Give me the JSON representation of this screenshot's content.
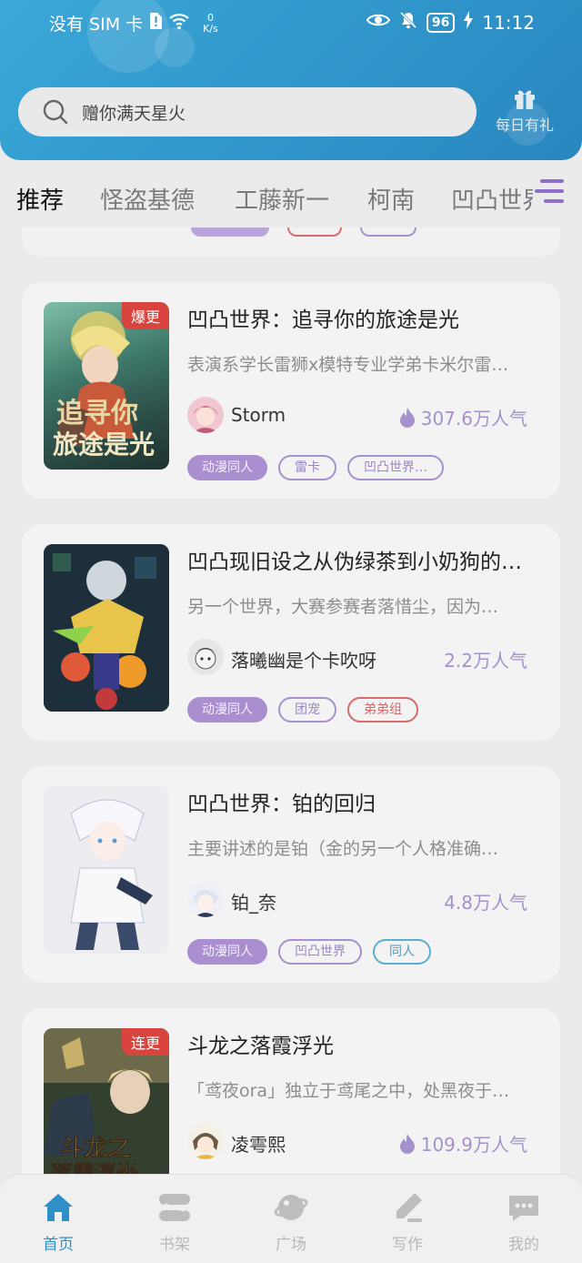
{
  "status_bar": {
    "carrier": "没有 SIM 卡",
    "speed_value": "0",
    "speed_unit": "K/s",
    "battery": "96",
    "time": "11:12"
  },
  "search": {
    "placeholder": "赠你满天星火"
  },
  "gift": {
    "label": "每日有礼"
  },
  "tabs": [
    {
      "label": "推荐",
      "active": true
    },
    {
      "label": "怪盗基德"
    },
    {
      "label": "工藤新一"
    },
    {
      "label": "柯南"
    },
    {
      "label": "凹凸世界"
    }
  ],
  "books": [
    {
      "badge": "爆更",
      "title": "凹凸世界：追寻你的旅途是光",
      "desc": "表演系学长雷狮x模特专业学弟卡米尔雷…",
      "author": "Storm",
      "popularity": "307.6万人气",
      "hot": true,
      "tags": [
        {
          "label": "动漫同人",
          "style": "filled"
        },
        {
          "label": "雷卡",
          "style": "outline-purple"
        },
        {
          "label": "凹凸世界…",
          "style": "outline-purple"
        }
      ]
    },
    {
      "badge": "",
      "title": "凹凸现旧设之从伪绿茶到小奶狗的…",
      "desc": "另一个世界，大赛参赛者落惜尘，因为…",
      "author": "落曦幽是个卡吹呀",
      "popularity": "2.2万人气",
      "hot": false,
      "tags": [
        {
          "label": "动漫同人",
          "style": "filled"
        },
        {
          "label": "团宠",
          "style": "outline-purple"
        },
        {
          "label": "弟弟组",
          "style": "outline-red"
        }
      ]
    },
    {
      "badge": "",
      "title": "凹凸世界：铂的回归",
      "desc": "主要讲述的是铂（金的另一个人格准确…",
      "author": "铂_奈",
      "popularity": "4.8万人气",
      "hot": false,
      "tags": [
        {
          "label": "动漫同人",
          "style": "filled"
        },
        {
          "label": "凹凸世界",
          "style": "outline-purple"
        },
        {
          "label": "同人",
          "style": "outline-blue"
        }
      ]
    },
    {
      "badge": "连更",
      "title": "斗龙之落霞浮光",
      "desc": "「鸢夜ora」独立于鸢尾之中，处黑夜于…",
      "author": "凌雩熙",
      "popularity": "109.9万人气",
      "hot": true,
      "tags": []
    }
  ],
  "nav": [
    {
      "label": "首页",
      "icon": "home-icon",
      "active": true
    },
    {
      "label": "书架",
      "icon": "bookshelf-icon"
    },
    {
      "label": "广场",
      "icon": "planet-icon"
    },
    {
      "label": "写作",
      "icon": "pen-icon"
    },
    {
      "label": "我的",
      "icon": "chat-bubble-icon"
    }
  ],
  "colors": {
    "header": "#2f94c9",
    "accent": "#a591cc",
    "badge": "#d9443f",
    "nav_active": "#2f8fc7"
  }
}
